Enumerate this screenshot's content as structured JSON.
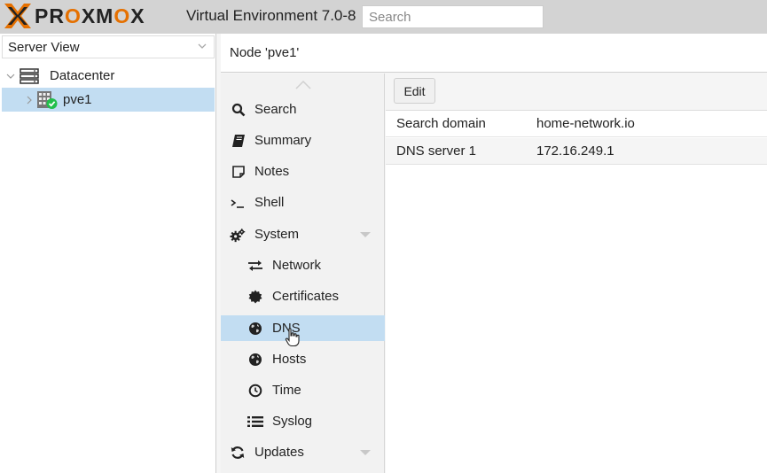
{
  "app": {
    "logo_letters": [
      "PR",
      "O",
      "XM",
      "O",
      "X"
    ],
    "title": "Virtual Environment 7.0-8",
    "search_placeholder": "Search"
  },
  "left_panel": {
    "view_selector": "Server View",
    "tree": [
      {
        "label": "Datacenter",
        "icon": "server-rack-icon"
      },
      {
        "label": "pve1",
        "icon": "node-online-icon",
        "selected": true
      }
    ]
  },
  "header": {
    "title": "Node 'pve1'"
  },
  "nav": {
    "items": [
      {
        "label": "Search",
        "icon": "search-icon"
      },
      {
        "label": "Summary",
        "icon": "book-icon"
      },
      {
        "label": "Notes",
        "icon": "note-icon"
      },
      {
        "label": "Shell",
        "icon": "terminal-icon"
      },
      {
        "label": "System",
        "icon": "gears-icon"
      },
      {
        "label": "Network",
        "icon": "exchange-icon"
      },
      {
        "label": "Certificates",
        "icon": "certificate-icon"
      },
      {
        "label": "DNS",
        "icon": "globe-icon",
        "selected": true
      },
      {
        "label": "Hosts",
        "icon": "globe-icon"
      },
      {
        "label": "Time",
        "icon": "clock-icon"
      },
      {
        "label": "Syslog",
        "icon": "list-icon"
      },
      {
        "label": "Updates",
        "icon": "refresh-icon"
      }
    ]
  },
  "main": {
    "edit_label": "Edit",
    "rows": [
      {
        "key": "Search domain",
        "value": "home-network.io"
      },
      {
        "key": "DNS server 1",
        "value": "172.16.249.1"
      }
    ]
  },
  "colors": {
    "selected": "#c2ddf2",
    "brand_orange": "#e57000",
    "online_green": "#21bf4b"
  }
}
